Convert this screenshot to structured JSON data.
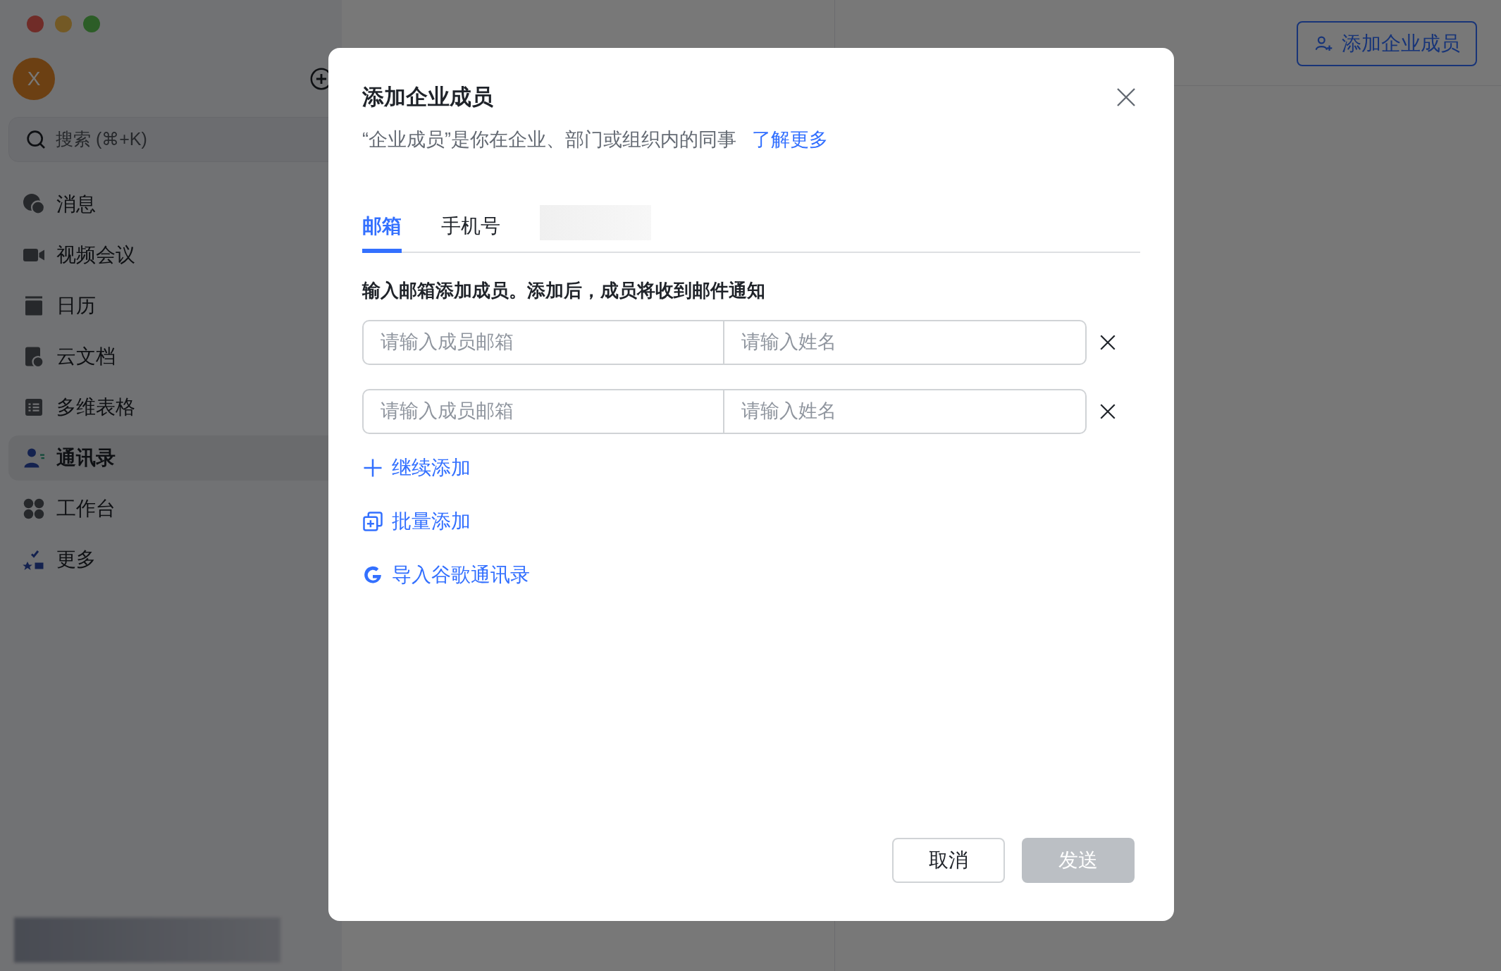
{
  "sidebar": {
    "avatar": {
      "initial": "X"
    },
    "search": {
      "placeholder": "搜索 (⌘+K)"
    },
    "items": [
      {
        "label": "消息",
        "selected": false
      },
      {
        "label": "视频会议",
        "selected": false
      },
      {
        "label": "日历",
        "selected": false
      },
      {
        "label": "云文档",
        "selected": false
      },
      {
        "label": "多维表格",
        "selected": false
      },
      {
        "label": "通讯录",
        "selected": true
      },
      {
        "label": "工作台",
        "selected": false
      },
      {
        "label": "更多",
        "selected": false
      }
    ]
  },
  "right": {
    "add_button": "添加企业成员"
  },
  "dialog": {
    "title": "添加企业成员",
    "subtitle": "“企业成员”是你在企业、部门或组织内的同事",
    "link": "了解更多",
    "tabs": [
      {
        "label": "邮箱",
        "selected": true
      },
      {
        "label": "手机号",
        "selected": false
      }
    ],
    "instruction": "输入邮箱添加成员。添加后，成员将收到邮件通知",
    "rows": [
      {
        "email_placeholder": "请输入成员邮箱",
        "name_placeholder": "请输入姓名"
      },
      {
        "email_placeholder": "请输入成员邮箱",
        "name_placeholder": "请输入姓名"
      }
    ],
    "actions": [
      {
        "kind": "plus",
        "label": "继续添加"
      },
      {
        "kind": "batch",
        "label": "批量添加"
      },
      {
        "kind": "google",
        "label": "导入谷歌通讯录"
      }
    ],
    "cancel": "取消",
    "send": {
      "label": "发送",
      "disabled": true
    }
  }
}
